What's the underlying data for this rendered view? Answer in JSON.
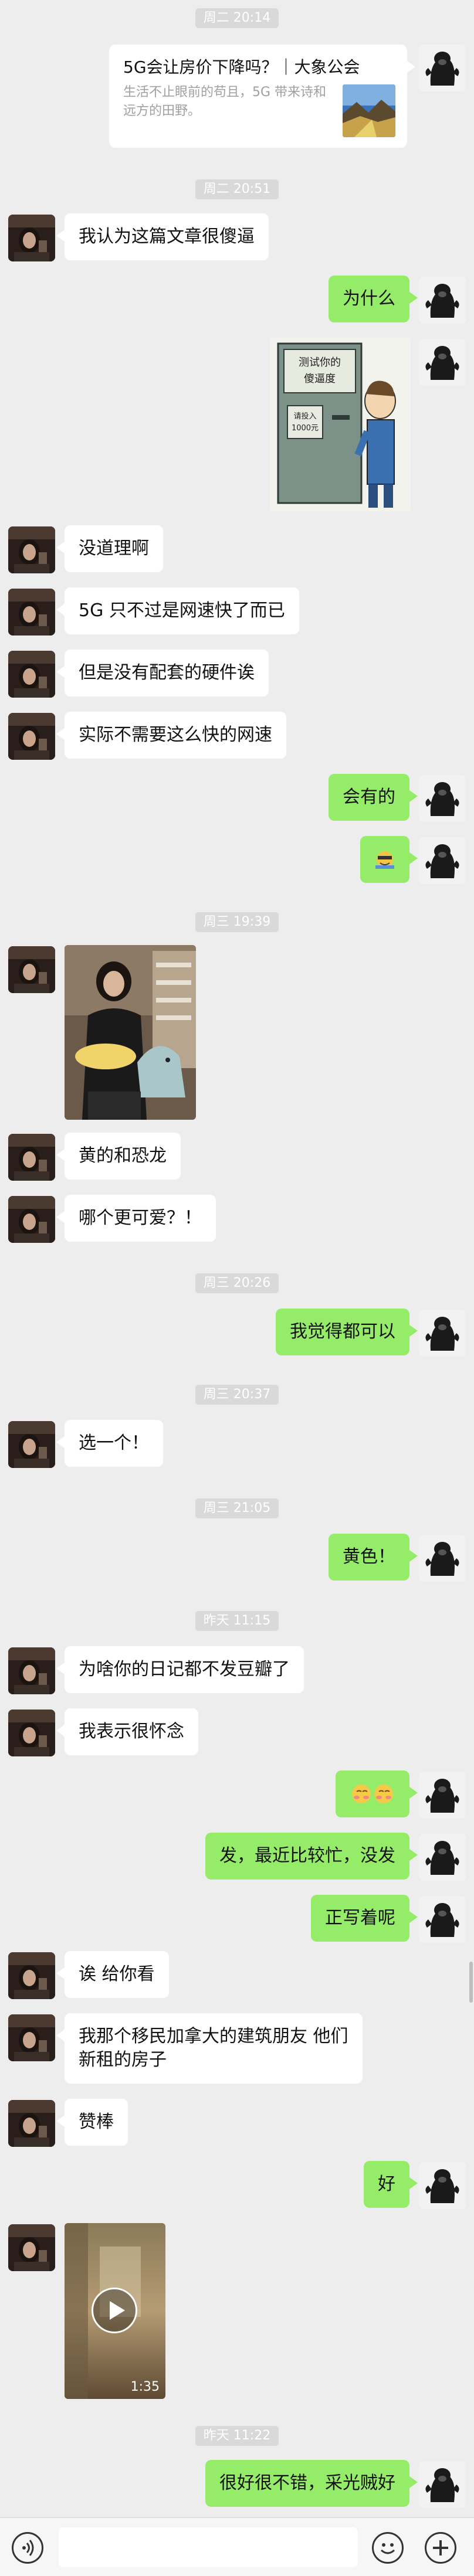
{
  "timestamps": [
    "周二 20:14",
    "周二 20:51",
    "周三 19:39",
    "周三 20:26",
    "周三 20:37",
    "周三 21:05",
    "昨天 11:15",
    "昨天 11:22"
  ],
  "article_card": {
    "title": "5G会让房价下降吗？｜大象公会",
    "description": "生活不止眼前的苟且，5G 带来诗和远方的田野。"
  },
  "sticker_text": [
    "测试你的",
    "傻逼度",
    "请投入",
    "1000元"
  ],
  "messages": {
    "m1": "我认为这篇文章很傻逼",
    "m2": "为什么",
    "m3": "没道理啊",
    "m4": "5G 只不过是网速快了而已",
    "m5": "但是没有配套的硬件诶",
    "m6": "实际不需要这么快的网速",
    "m7": "会有的",
    "m8": "黄的和恐龙",
    "m9": "哪个更可爱？！",
    "m10": "我觉得都可以",
    "m11": "选一个！",
    "m12": "黄色！",
    "m13": "为啥你的日记都不发豆瓣了",
    "m14": "我表示很怀念",
    "m15": "发，最近比较忙，没发",
    "m16": "正写着呢",
    "m17": "诶 给你看",
    "m18_line1": "我那个移民加拿大的建筑朋友 他们",
    "m18_line2": "新租的房子",
    "m19": "赞棒",
    "m20": "好",
    "m21": "很好很不错，采光贼好"
  },
  "video": {
    "duration": "1:35"
  },
  "icons": {
    "voice": "voice-icon",
    "emoji": "emoji-icon",
    "add": "add-icon",
    "play": "play-icon"
  },
  "colors": {
    "outgoing_bubble": "#95ec69",
    "incoming_bubble": "#ffffff",
    "background": "#ededed"
  }
}
